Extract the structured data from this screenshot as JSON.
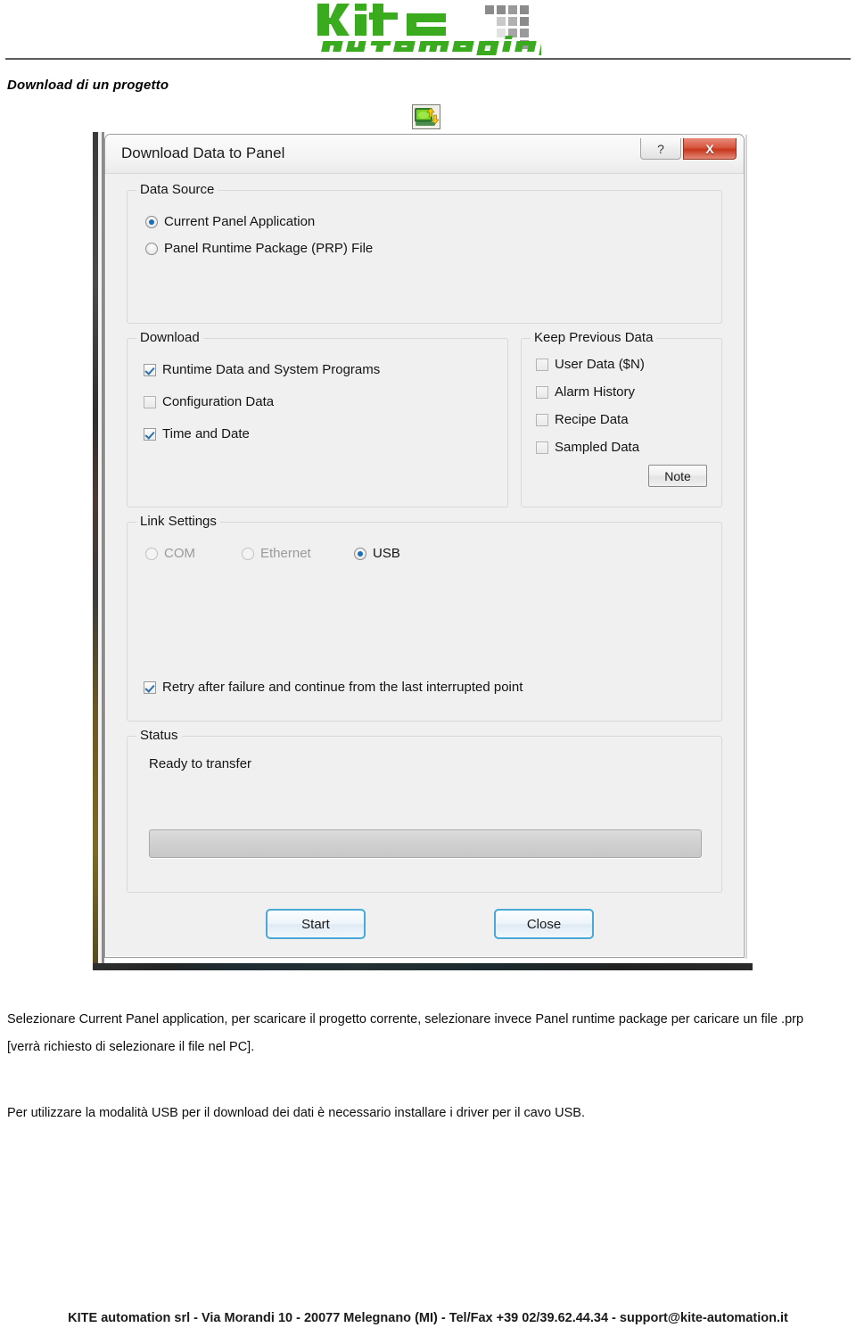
{
  "header": {
    "logo_main": "kite",
    "logo_sub": "automation"
  },
  "page_title": "Download di un progetto",
  "toolbar": {
    "download_icon_name": "download-to-panel-icon"
  },
  "dialog": {
    "title": "Download Data to Panel",
    "help_button": "?",
    "close_button": "X",
    "data_source": {
      "legend": "Data Source",
      "options": [
        {
          "label": "Current Panel Application",
          "selected": true
        },
        {
          "label": "Panel Runtime Package (PRP) File",
          "selected": false
        }
      ]
    },
    "download": {
      "legend": "Download",
      "items": [
        {
          "label": "Runtime Data and System Programs",
          "checked": true
        },
        {
          "label": "Configuration Data",
          "checked": false
        },
        {
          "label": "Time and Date",
          "checked": true
        }
      ]
    },
    "keep_previous_data": {
      "legend": "Keep Previous Data",
      "items": [
        {
          "label": "User Data ($N)",
          "checked": false
        },
        {
          "label": "Alarm History",
          "checked": false
        },
        {
          "label": "Recipe Data",
          "checked": false
        },
        {
          "label": "Sampled Data",
          "checked": false
        }
      ],
      "note_button": "Note"
    },
    "link_settings": {
      "legend": "Link Settings",
      "options": [
        {
          "label": "COM",
          "selected": false,
          "disabled": true
        },
        {
          "label": "Ethernet",
          "selected": false,
          "disabled": true
        },
        {
          "label": "USB",
          "selected": true,
          "disabled": false
        }
      ],
      "retry": {
        "label": "Retry after failure and continue from the last interrupted point",
        "checked": true
      }
    },
    "status": {
      "legend": "Status",
      "message": "Ready to transfer",
      "progress_percent": 0
    },
    "buttons": {
      "start": "Start",
      "close": "Close"
    }
  },
  "body": {
    "paragraph1": "Selezionare Current Panel application, per scaricare il progetto corrente, selezionare invece Panel runtime package per caricare un file .prp [verrà richiesto di selezionare il file nel PC].",
    "paragraph2": "Per utilizzare la modalità USB per il download dei dati è necessario installare i driver per il cavo USB."
  },
  "footer": "KITE automation srl - Via Morandi 10 - 20077 Melegnano (MI) - Tel/Fax +39 02/39.62.44.34 - support@kite-automation.it",
  "colors": {
    "brand_green": "#3aaa1e",
    "accent_blue": "#4aa8d8",
    "close_red": "#c8341c",
    "radio_dot": "#1a6fb5"
  }
}
